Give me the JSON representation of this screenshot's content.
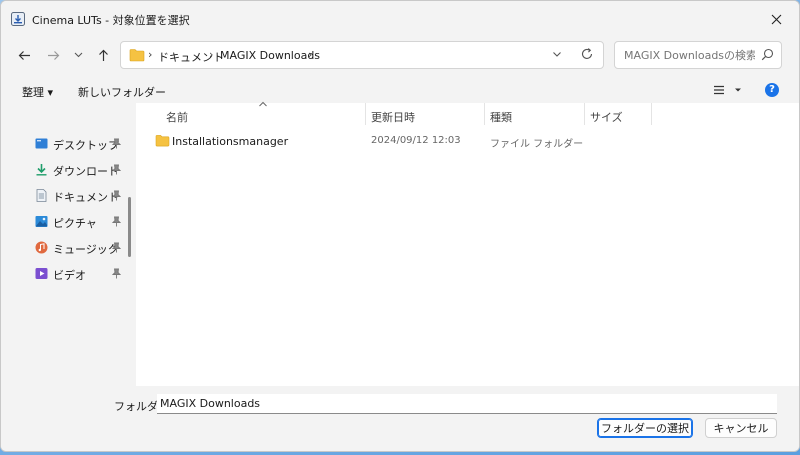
{
  "window": {
    "title": "Cinema LUTs - 対象位置を選択"
  },
  "address": {
    "crumbs": [
      "ドキュメント",
      "MAGIX Downloads"
    ],
    "separator": "›"
  },
  "search": {
    "placeholder": "MAGIX Downloadsの検索"
  },
  "toolbar": {
    "organize_label": "整理 ▾",
    "new_folder_label": "新しいフォルダー"
  },
  "sidebar": {
    "items": [
      {
        "label": "デスクトップ",
        "icon": "desktop-icon"
      },
      {
        "label": "ダウンロード",
        "icon": "download-icon"
      },
      {
        "label": "ドキュメント",
        "icon": "document-icon"
      },
      {
        "label": "ピクチャ",
        "icon": "picture-icon"
      },
      {
        "label": "ミュージック",
        "icon": "music-icon"
      },
      {
        "label": "ビデオ",
        "icon": "video-icon"
      }
    ]
  },
  "columns": {
    "name": "名前",
    "modified": "更新日時",
    "type": "種類",
    "size": "サイズ"
  },
  "files": [
    {
      "name": "Installationsmanager",
      "modified": "2024/09/12 12:03",
      "type": "ファイル フォルダー"
    }
  ],
  "footer": {
    "folder_label": "フォルダー:",
    "folder_value": "MAGIX Downloads",
    "select_label": "フォルダーの選択",
    "cancel_label": "キャンセル"
  },
  "colors": {
    "accent": "#1a73e8",
    "folder": "#f5c242"
  }
}
